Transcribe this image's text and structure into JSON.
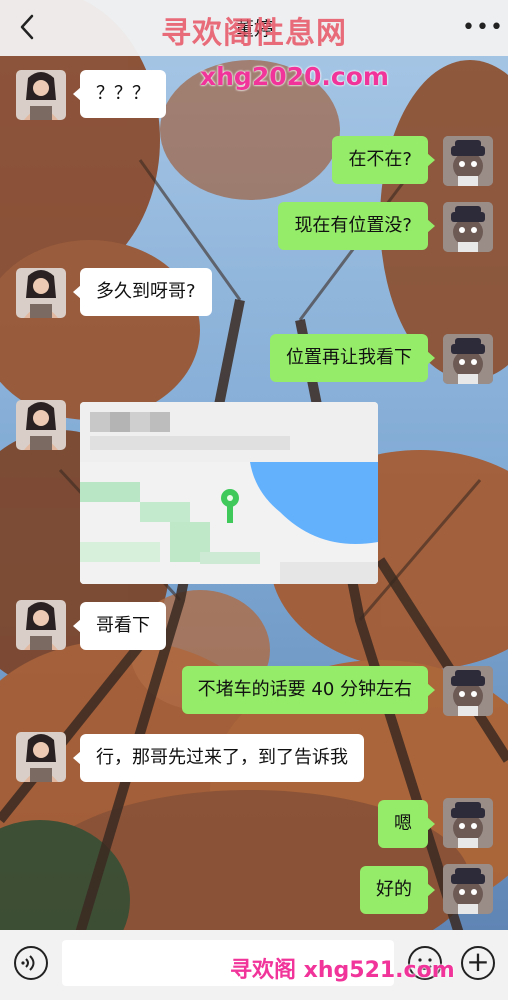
{
  "header": {
    "title": "董婷",
    "back_icon": "chevron-left-icon",
    "more_icon": "more-dots-icon"
  },
  "watermarks": {
    "top": "寻欢阁性息网",
    "url": "xhg2020.com",
    "bottom": "寻欢阁 xhg521.com"
  },
  "messages": [
    {
      "from": "contact",
      "text": "？？？"
    },
    {
      "from": "me",
      "text": "在不在?"
    },
    {
      "from": "me",
      "text": "现在有位置没?"
    },
    {
      "from": "contact",
      "text": "多久到呀哥?"
    },
    {
      "from": "me",
      "text": "位置再让我看下"
    },
    {
      "from": "contact",
      "type": "location",
      "text": ""
    },
    {
      "from": "contact",
      "text": "哥看下"
    },
    {
      "from": "me",
      "text": "不堵车的话要 40 分钟左右"
    },
    {
      "from": "contact",
      "text": "行，那哥先过来了，到了告诉我"
    },
    {
      "from": "me",
      "text": "嗯"
    },
    {
      "from": "me",
      "text": "好的"
    }
  ],
  "input_bar": {
    "voice_icon": "voice-icon",
    "emoji_icon": "emoji-icon",
    "plus_icon": "plus-icon",
    "input_value": ""
  },
  "colors": {
    "outgoing_bubble": "#95ec69",
    "incoming_bubble": "#ffffff",
    "map_pin": "#3fc95a",
    "map_water": "#4aa6ff"
  }
}
